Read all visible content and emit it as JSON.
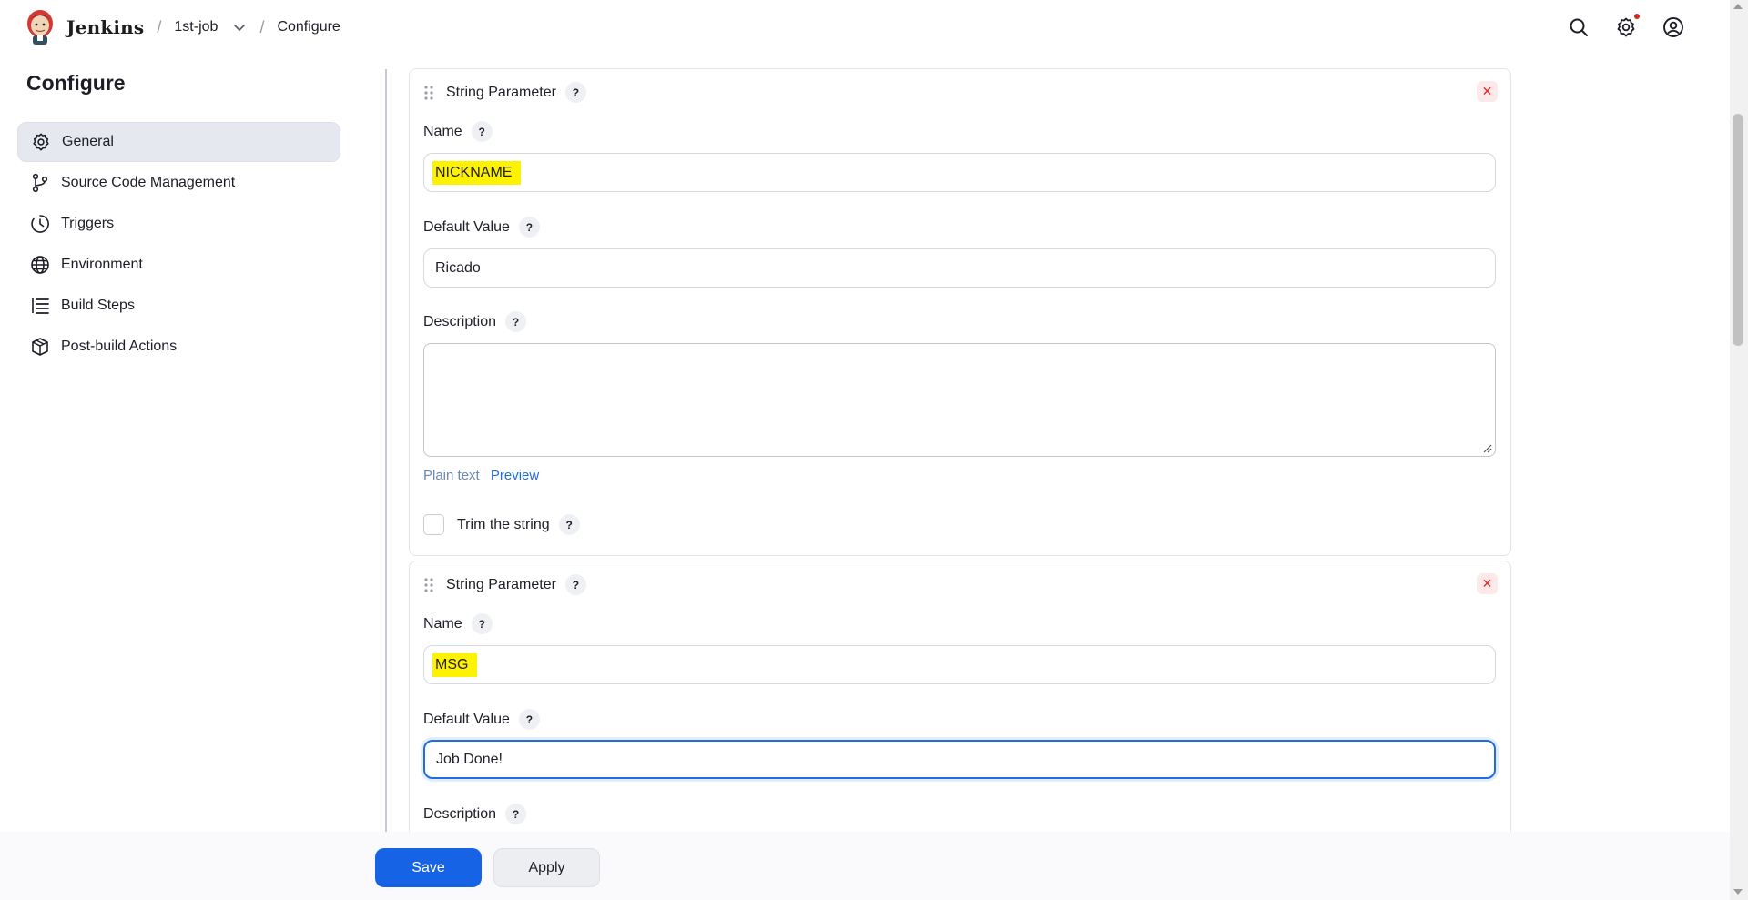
{
  "header": {
    "brand": "Jenkins",
    "breadcrumbs": [
      "1st-job",
      "Configure"
    ],
    "icons": [
      "search-icon",
      "settings-icon",
      "user-icon"
    ],
    "notification_color": "#e0241b"
  },
  "sidebar": {
    "title": "Configure",
    "items": [
      {
        "label": "General",
        "icon": "gear-icon",
        "active": true
      },
      {
        "label": "Source Code Management",
        "icon": "branch-icon"
      },
      {
        "label": "Triggers",
        "icon": "clock-icon"
      },
      {
        "label": "Environment",
        "icon": "globe-icon"
      },
      {
        "label": "Build Steps",
        "icon": "list-icon"
      },
      {
        "label": "Post-build Actions",
        "icon": "box-icon"
      }
    ]
  },
  "params": [
    {
      "title": "String Parameter",
      "name_label": "Name",
      "name_value": "NICKNAME",
      "default_label": "Default Value",
      "default_value": "Ricado",
      "description_label": "Description",
      "plain_text": "Plain text",
      "preview": "Preview",
      "trim_label": "Trim the string"
    },
    {
      "title": "String Parameter",
      "name_label": "Name",
      "name_value": "MSG",
      "default_label": "Default Value",
      "default_value": "Job Done!",
      "description_label": "Description"
    }
  ],
  "help_mark": "?",
  "close_mark": "✕",
  "actions": {
    "save": "Save",
    "apply": "Apply"
  },
  "colors": {
    "accent": "#1664e5",
    "highlight": "#fff200",
    "danger": "#d92a2a"
  }
}
